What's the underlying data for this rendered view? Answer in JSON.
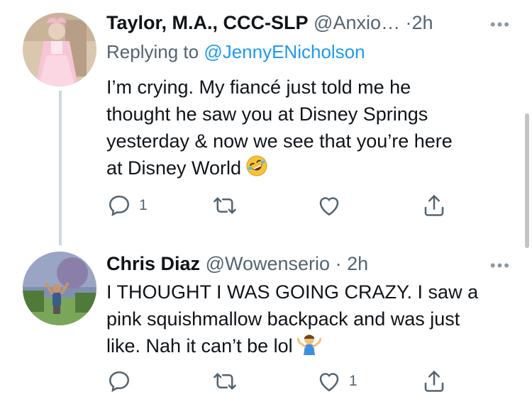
{
  "tweets": [
    {
      "display_name": "Taylor, M.A., CCC-SLP",
      "handle": "@Anxio…",
      "separator": "·",
      "time": "2h",
      "more": "•••",
      "replying_prefix": "Replying to",
      "replying_to": "@JennyENicholson",
      "text_lines": [
        "I’m crying. My fiancé just told me he",
        "thought he saw you at Disney Springs",
        "yesterday & now we see that you’re here",
        "at Disney World"
      ],
      "text_emoji": "rolling-on-floor-laughing-emoji",
      "reply_count": "1",
      "retweet_count": "",
      "like_count": "",
      "avatar_icon": "avatar-pink-dress-photo"
    },
    {
      "display_name": "Chris Diaz",
      "handle": "@Wowenserio",
      "separator": "·",
      "time": "2h",
      "more": "•••",
      "text_lines": [
        "I THOUGHT I WAS GOING CRAZY. I saw a",
        "pink squishmallow backpack and was just",
        "like. Nah it can’t be lol"
      ],
      "text_emoji": "man-shrugging-emoji",
      "reply_count": "",
      "retweet_count": "",
      "like_count": "1",
      "avatar_icon": "avatar-outdoor-photo"
    }
  ],
  "colors": {
    "text": "#0f1419",
    "secondary": "#536471",
    "link": "#1d9bf0",
    "thread_line": "#cfd9de"
  }
}
